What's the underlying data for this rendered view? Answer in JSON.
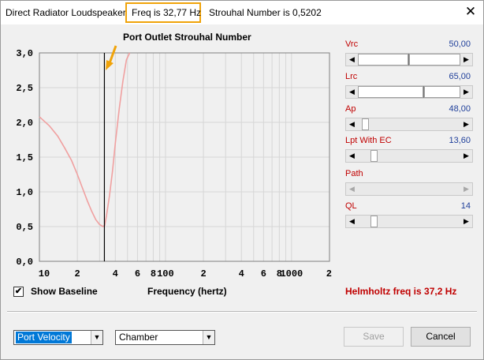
{
  "window": {
    "title": "Direct Radiator Loudspeaker",
    "freq_readout": "Freq is 32,77 Hz",
    "strouhal_readout": "Strouhal Number is 0,5202",
    "close_icon": "close-icon"
  },
  "chart_data": {
    "type": "line",
    "title": "Port Outlet Strouhal Number",
    "xlabel": "Frequency (hertz)",
    "ylabel": "",
    "x_scale": "log",
    "xlim": [
      10,
      2000
    ],
    "ylim": [
      0,
      3.0
    ],
    "y_ticks": [
      "3,0",
      "2,5",
      "2,0",
      "1,5",
      "1,0",
      "0,5",
      "0,0"
    ],
    "x_tick_labels": [
      "10",
      "2",
      "4",
      "6",
      "8",
      "100",
      "2",
      "4",
      "6",
      "8",
      "1000",
      "2"
    ],
    "grid": true,
    "marker_frequency": 32.77,
    "series": [
      {
        "color": "#f0a0a0",
        "x": [
          10,
          12,
          14,
          16,
          18,
          20,
          22,
          24,
          26,
          28,
          30,
          32,
          33,
          34,
          36,
          38,
          40,
          43,
          46,
          49,
          52
        ],
        "values": [
          2.08,
          1.95,
          1.8,
          1.62,
          1.45,
          1.25,
          1.05,
          0.87,
          0.72,
          0.6,
          0.53,
          0.5,
          0.52,
          0.65,
          0.95,
          1.3,
          1.7,
          2.2,
          2.6,
          2.9,
          3.05
        ]
      }
    ]
  },
  "controls": {
    "sliders": [
      {
        "label": "Vrc",
        "value": "50,00",
        "fraction": 0.49,
        "enabled": true
      },
      {
        "label": "Lrc",
        "value": "65,00",
        "fraction": 0.64,
        "enabled": true
      },
      {
        "label": "Ap",
        "value": "48,00",
        "fraction": 0.04,
        "enabled": true
      },
      {
        "label": "Lpt  With EC",
        "value": "13,60",
        "fraction": 0.12,
        "enabled": true
      },
      {
        "label": "Path",
        "value": "",
        "fraction": null,
        "enabled": false
      },
      {
        "label": "QL",
        "value": "14",
        "fraction": 0.12,
        "enabled": true
      }
    ],
    "show_baseline_label": "Show Baseline",
    "show_baseline_checked": "✔",
    "helmholtz": "Helmholtz freq is 37,2 Hz"
  },
  "footer": {
    "plot_select": "Port Velocity",
    "region_select": "Chamber",
    "save_label": "Save",
    "cancel_label": "Cancel"
  },
  "colors": {
    "highlight": "#f0a30a",
    "param_label": "#c00000",
    "param_value": "#1f3f9a",
    "curve": "#f0a0a0",
    "selection": "#0078d7"
  }
}
